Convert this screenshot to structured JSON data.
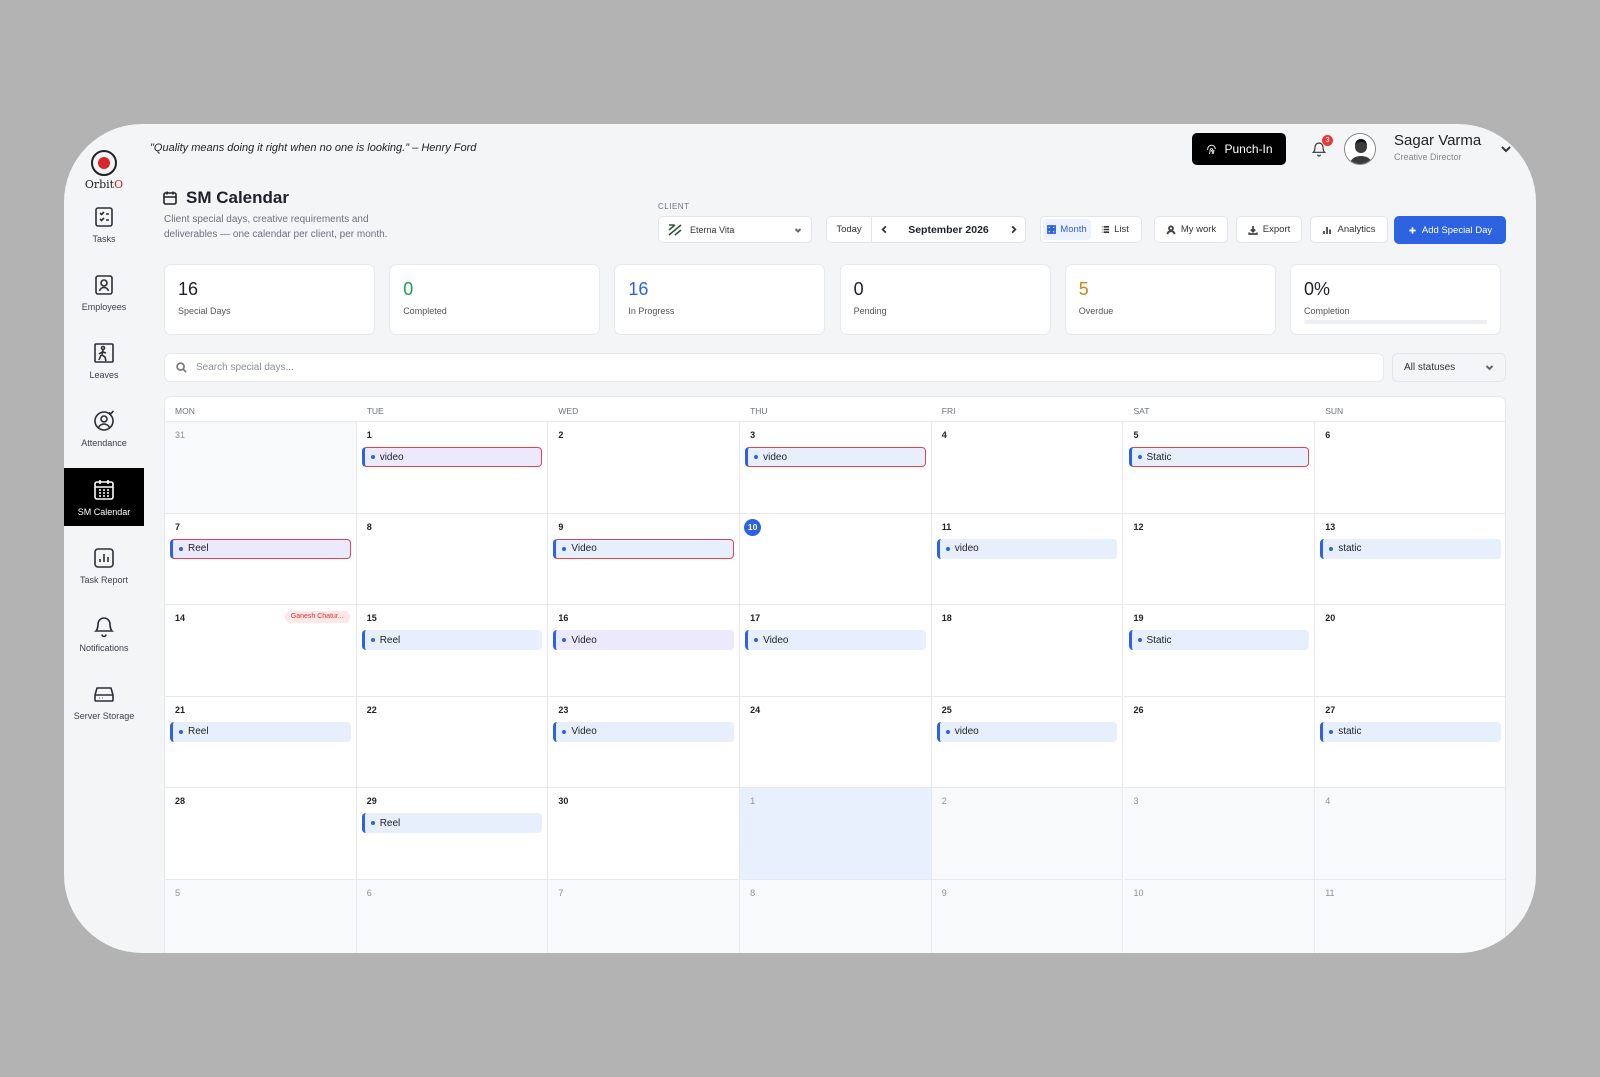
{
  "app": {
    "logo_text": "Orbit",
    "logo_accent": "O"
  },
  "colors": {
    "primary": "#2d62e0",
    "green": "#1f9d55",
    "blue": "#2d62e0",
    "amber": "#c98a16",
    "danger": "#e0454f",
    "brand_red": "#d9262b"
  },
  "quote": "\"Quality means doing it right when no one is looking.\" – Henry Ford",
  "sidebar": {
    "items": [
      {
        "label": "Tasks",
        "icon": "tasks-icon"
      },
      {
        "label": "Employees",
        "icon": "employees-icon"
      },
      {
        "label": "Leaves",
        "icon": "leaves-icon"
      },
      {
        "label": "Attendance",
        "icon": "attendance-icon"
      },
      {
        "label": "SM Calendar",
        "icon": "calendar-grid-icon",
        "active": true
      },
      {
        "label": "Task Report",
        "icon": "report-icon"
      },
      {
        "label": "Notifications",
        "icon": "bell-icon"
      },
      {
        "label": "Server Storage",
        "icon": "storage-icon"
      }
    ]
  },
  "topbar": {
    "punch_label": "Punch-In",
    "notification_count": "3",
    "user_name": "Sagar Varma",
    "user_role": "Creative Director"
  },
  "page": {
    "title": "SM Calendar",
    "subtitle": "Client special days, creative requirements and deliverables — one calendar per client, per month."
  },
  "toolbar": {
    "client_label": "CLIENT",
    "client_value": "Eterna Vita",
    "today_label": "Today",
    "month_label": "September 2026",
    "view_month": "Month",
    "view_list": "List",
    "my_work": "My work",
    "export": "Export",
    "analytics": "Analytics",
    "add_label": "Add Special Day"
  },
  "stats": [
    {
      "value": "16",
      "label": "Special Days",
      "color": "#1d2129"
    },
    {
      "value": "0",
      "label": "Completed",
      "color": "#1f9d55"
    },
    {
      "value": "16",
      "label": "In Progress",
      "color": "#2d62e0"
    },
    {
      "value": "0",
      "label": "Pending",
      "color": "#1d2129"
    },
    {
      "value": "5",
      "label": "Overdue",
      "color": "#c98a16"
    },
    {
      "value": "0%",
      "label": "Completion",
      "color": "#1d2129",
      "progress": 0
    }
  ],
  "search": {
    "placeholder": "Search special days...",
    "status_value": "All statuses"
  },
  "calendar": {
    "weekdays": [
      "MON",
      "TUE",
      "WED",
      "THU",
      "FRI",
      "SAT",
      "SUN"
    ],
    "today": 10,
    "weeks": [
      [
        {
          "day": "31",
          "out": true
        },
        {
          "day": "1",
          "events": [
            {
              "label": "video",
              "style": "purple",
              "overdue": true
            }
          ]
        },
        {
          "day": "2"
        },
        {
          "day": "3",
          "events": [
            {
              "label": "video",
              "style": "blue",
              "overdue": true
            }
          ]
        },
        {
          "day": "4"
        },
        {
          "day": "5",
          "events": [
            {
              "label": "Static",
              "style": "blue",
              "overdue": true
            }
          ]
        },
        {
          "day": "6"
        }
      ],
      [
        {
          "day": "7",
          "events": [
            {
              "label": "Reel",
              "style": "purple",
              "overdue": true
            }
          ]
        },
        {
          "day": "8"
        },
        {
          "day": "9",
          "events": [
            {
              "label": "Video",
              "style": "blue",
              "overdue": true
            }
          ]
        },
        {
          "day": "10",
          "today": true
        },
        {
          "day": "11",
          "events": [
            {
              "label": "video",
              "style": "blue"
            }
          ]
        },
        {
          "day": "12"
        },
        {
          "day": "13",
          "events": [
            {
              "label": "static",
              "style": "blue"
            }
          ]
        }
      ],
      [
        {
          "day": "14",
          "holiday": "Ganesh Chatur..."
        },
        {
          "day": "15",
          "events": [
            {
              "label": "Reel",
              "style": "blue"
            }
          ]
        },
        {
          "day": "16",
          "events": [
            {
              "label": "Video",
              "style": "purple"
            }
          ]
        },
        {
          "day": "17",
          "events": [
            {
              "label": "Video",
              "style": "blue"
            }
          ]
        },
        {
          "day": "18"
        },
        {
          "day": "19",
          "events": [
            {
              "label": "Static",
              "style": "blue"
            }
          ]
        },
        {
          "day": "20"
        }
      ],
      [
        {
          "day": "21",
          "events": [
            {
              "label": "Reel",
              "style": "blue"
            }
          ]
        },
        {
          "day": "22"
        },
        {
          "day": "23",
          "events": [
            {
              "label": "Video",
              "style": "blue"
            }
          ]
        },
        {
          "day": "24"
        },
        {
          "day": "25",
          "events": [
            {
              "label": "video",
              "style": "blue"
            }
          ]
        },
        {
          "day": "26"
        },
        {
          "day": "27",
          "events": [
            {
              "label": "static",
              "style": "blue"
            }
          ]
        }
      ],
      [
        {
          "day": "28"
        },
        {
          "day": "29",
          "events": [
            {
              "label": "Reel",
              "style": "blue"
            }
          ]
        },
        {
          "day": "30"
        },
        {
          "day": "1",
          "out": true,
          "highlight": true
        },
        {
          "day": "2",
          "out": true
        },
        {
          "day": "3",
          "out": true
        },
        {
          "day": "4",
          "out": true
        }
      ],
      [
        {
          "day": "5",
          "out": true
        },
        {
          "day": "6",
          "out": true
        },
        {
          "day": "7",
          "out": true
        },
        {
          "day": "8",
          "out": true
        },
        {
          "day": "9",
          "out": true
        },
        {
          "day": "10",
          "out": true
        },
        {
          "day": "11",
          "out": true
        }
      ]
    ]
  }
}
